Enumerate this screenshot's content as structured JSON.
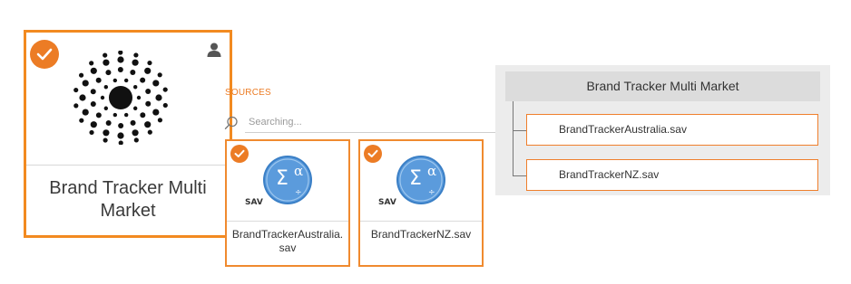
{
  "project": {
    "title": "Brand Tracker Multi Market",
    "selected": true,
    "icons": {
      "check": "check-icon",
      "owner": "user-icon",
      "logo": "dotted-sunburst-logo"
    }
  },
  "sources_panel": {
    "label": "SOURCES",
    "search": {
      "placeholder": "Searching...",
      "value": ""
    },
    "cards": [
      {
        "name": "BrandTrackerAustralia.sav",
        "type_label": "SAV",
        "selected": true,
        "icon": "spss-sav-file-icon"
      },
      {
        "name": "BrandTrackerNZ.sav",
        "type_label": "SAV",
        "selected": true,
        "icon": "spss-sav-file-icon"
      }
    ]
  },
  "tree": {
    "root_label": "Brand Tracker Multi Market",
    "children": [
      {
        "label": "BrandTrackerAustralia.sav"
      },
      {
        "label": "BrandTrackerNZ.sav"
      }
    ]
  },
  "colors": {
    "accent": "#f28a20",
    "check_badge": "#ec7c25",
    "spss_icon_blue": "#3a7fc6",
    "tree_panel_bg": "#ececec",
    "tree_root_bg": "#dcdcdc"
  }
}
